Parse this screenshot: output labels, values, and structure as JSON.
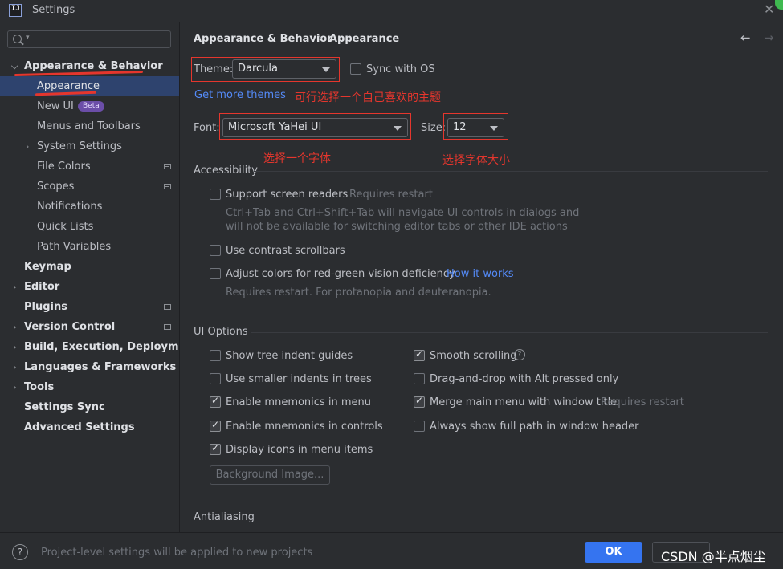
{
  "window": {
    "title": "Settings"
  },
  "search": {
    "placeholder": ""
  },
  "sidebar": {
    "items": [
      {
        "label": "Appearance & Behavior",
        "level": 0,
        "expanded": true
      },
      {
        "label": "Appearance",
        "level": 1,
        "selected": true
      },
      {
        "label": "New UI",
        "level": 1,
        "badge": "Beta"
      },
      {
        "label": "Menus and Toolbars",
        "level": 1
      },
      {
        "label": "System Settings",
        "level": 1,
        "collapsible": true
      },
      {
        "label": "File Colors",
        "level": 1
      },
      {
        "label": "Scopes",
        "level": 1
      },
      {
        "label": "Notifications",
        "level": 1
      },
      {
        "label": "Quick Lists",
        "level": 1
      },
      {
        "label": "Path Variables",
        "level": 1
      },
      {
        "label": "Keymap",
        "level": 0
      },
      {
        "label": "Editor",
        "level": 0,
        "collapsible": true
      },
      {
        "label": "Plugins",
        "level": 0
      },
      {
        "label": "Version Control",
        "level": 0,
        "collapsible": true
      },
      {
        "label": "Build, Execution, Deployment",
        "level": 0,
        "collapsible": true
      },
      {
        "label": "Languages & Frameworks",
        "level": 0,
        "collapsible": true
      },
      {
        "label": "Tools",
        "level": 0,
        "collapsible": true
      },
      {
        "label": "Settings Sync",
        "level": 0
      },
      {
        "label": "Advanced Settings",
        "level": 0
      }
    ]
  },
  "breadcrumb": {
    "parent": "Appearance & Behavior",
    "separator": "›",
    "current": "Appearance"
  },
  "theme": {
    "label": "Theme:",
    "value": "Darcula",
    "sync_label": "Sync with OS",
    "get_more": "Get more themes",
    "annotation": "可行选择一个自己喜欢的主题"
  },
  "font": {
    "label": "Font:",
    "value": "Microsoft YaHei UI",
    "size_label": "Size:",
    "size_value": "12",
    "font_annotation": "选择一个字体",
    "size_annotation": "选择字体大小"
  },
  "accessibility": {
    "title": "Accessibility",
    "screen_readers": "Support screen readers",
    "screen_readers_note": "Requires restart",
    "screen_readers_desc1": "Ctrl+Tab and Ctrl+Shift+Tab will navigate UI controls in dialogs and",
    "screen_readers_desc2": "will not be available for switching editor tabs or other IDE actions",
    "contrast_scrollbars": "Use contrast scrollbars",
    "adjust_colors": "Adjust colors for red-green vision deficiency",
    "how_it_works": "How it works",
    "adjust_desc": "Requires restart. For protanopia and deuteranopia."
  },
  "ui_options": {
    "title": "UI Options",
    "left": [
      {
        "label": "Show tree indent guides",
        "checked": false
      },
      {
        "label": "Use smaller indents in trees",
        "checked": false
      },
      {
        "label": "Enable mnemonics in menu",
        "checked": true
      },
      {
        "label": "Enable mnemonics in controls",
        "checked": true
      },
      {
        "label": "Display icons in menu items",
        "checked": true
      }
    ],
    "right": [
      {
        "label": "Smooth scrolling",
        "checked": true
      },
      {
        "label": "Drag-and-drop with Alt pressed only",
        "checked": false
      },
      {
        "label": "Merge main menu with window title",
        "checked": true,
        "note": "Requires restart"
      },
      {
        "label": "Always show full path in window header",
        "checked": false
      }
    ],
    "background_button": "Background Image..."
  },
  "antialiasing": {
    "title": "Antialiasing"
  },
  "footer": {
    "note": "Project-level settings will be applied to new projects",
    "ok": "OK",
    "watermark": "CSDN @半点烟尘"
  },
  "colors": {
    "accent": "#3574f0",
    "selection": "#2e436e",
    "annotation_red": "#e5362d",
    "link": "#548af7"
  }
}
